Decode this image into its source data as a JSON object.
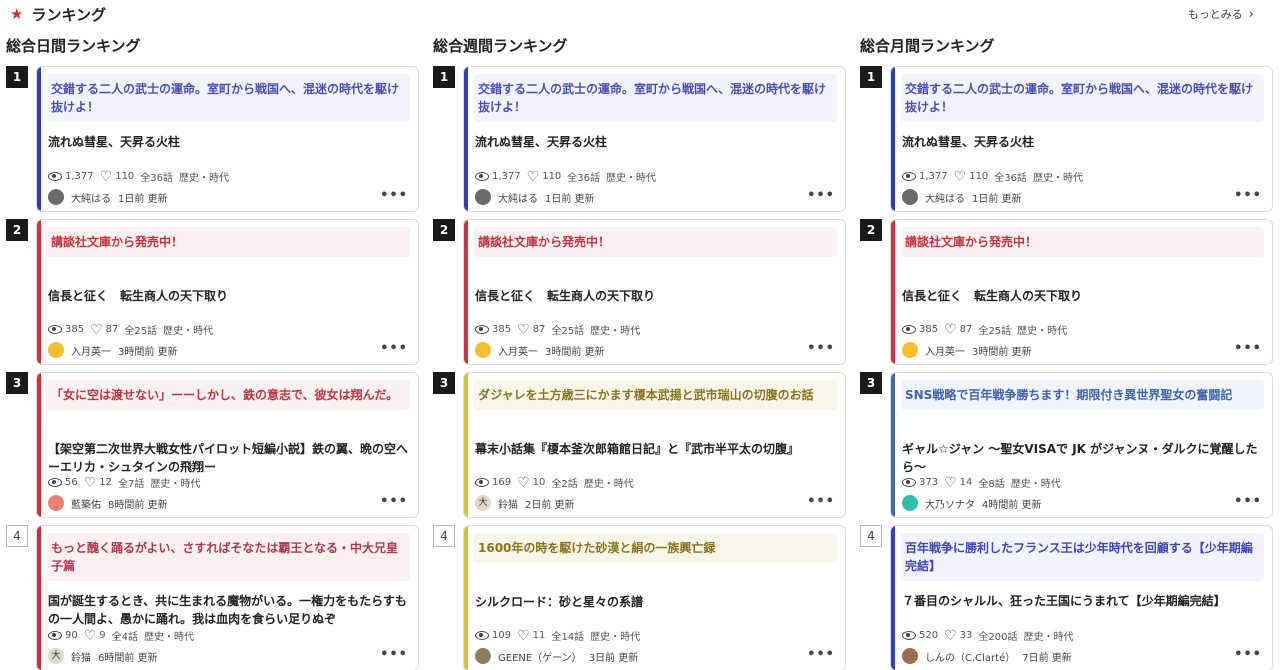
{
  "header": {
    "title": "ランキング",
    "more_label": "もっとみる"
  },
  "columns": [
    {
      "title": "総合日間ランキング",
      "items": [
        {
          "rank": "1",
          "style": "blue",
          "banner": "交錯する二人の武士の運命。室町から戦国へ、混迷の時代を駆け抜けよ！",
          "title": "流れぬ彗星、天昇る火柱",
          "views": "1,377",
          "likes": "110",
          "episodes": "全36話",
          "genre": "歴史・時代",
          "author": "大純はる",
          "updated": "1日前 更新",
          "avatar_color": "#6a6a6a",
          "avatar_glyph": ""
        },
        {
          "rank": "2",
          "style": "red",
          "banner": "講談社文庫から発売中！",
          "title": "信長と征く　転生商人の天下取り",
          "views": "385",
          "likes": "87",
          "episodes": "全25話",
          "genre": "歴史・時代",
          "author": "入月英一",
          "updated": "3時間前 更新",
          "avatar_color": "#f5c030",
          "avatar_glyph": ""
        },
        {
          "rank": "3",
          "style": "red",
          "banner": "「女に空は渡せない」ーーしかし、鉄の意志で、彼女は翔んだ。",
          "title": "【架空第二次世界大戦女性パイロット短編小説】鉄の翼、晩の空へ　ーエリカ・シュタインの飛翔ー",
          "views": "56",
          "likes": "12",
          "episodes": "全7話",
          "genre": "歴史・時代",
          "author": "藍築佑",
          "updated": "8時間前 更新",
          "avatar_color": "#f08070",
          "avatar_glyph": ""
        },
        {
          "rank": "4",
          "style": "maroon",
          "banner": "もっと醜く踊るがよい、さすればそなたは覇王となる・中大兄皇子篇",
          "title": "国が誕生するとき、共に生まれる魔物がいる。一権力をもたらすもの一人間よ、愚かに踊れ。我は血肉を食らい足りぬぞ",
          "views": "90",
          "likes": "9",
          "episodes": "全4話",
          "genre": "歴史・時代",
          "author": "鈴猫",
          "updated": "6時間前 更新",
          "avatar_color": "#e0d8c8",
          "avatar_glyph": "大"
        }
      ]
    },
    {
      "title": "総合週間ランキング",
      "items": [
        {
          "rank": "1",
          "style": "blue",
          "banner": "交錯する二人の武士の運命。室町から戦国へ、混迷の時代を駆け抜けよ！",
          "title": "流れぬ彗星、天昇る火柱",
          "views": "1,377",
          "likes": "110",
          "episodes": "全36話",
          "genre": "歴史・時代",
          "author": "大純はる",
          "updated": "1日前 更新",
          "avatar_color": "#6a6a6a",
          "avatar_glyph": ""
        },
        {
          "rank": "2",
          "style": "red",
          "banner": "講談社文庫から発売中！",
          "title": "信長と征く　転生商人の天下取り",
          "views": "385",
          "likes": "87",
          "episodes": "全25話",
          "genre": "歴史・時代",
          "author": "入月英一",
          "updated": "3時間前 更新",
          "avatar_color": "#f5c030",
          "avatar_glyph": ""
        },
        {
          "rank": "3",
          "style": "yellow",
          "banner": "ダジャレを土方歳三にかます榎本武揚と武市瑞山の切腹のお話",
          "title": "幕末小話集『榎本釜次郎箱館日記』と『武市半平太の切腹』",
          "views": "169",
          "likes": "10",
          "episodes": "全2話",
          "genre": "歴史・時代",
          "author": "鈴猫",
          "updated": "2日前 更新",
          "avatar_color": "#e0d8c8",
          "avatar_glyph": "大"
        },
        {
          "rank": "4",
          "style": "yellow",
          "banner": "1600年の時を駆けた砂漠と絹の一族興亡録",
          "title": "シルクロード：砂と星々の系譜",
          "views": "109",
          "likes": "11",
          "episodes": "全14話",
          "genre": "歴史・時代",
          "author": "GEENE（ゲーン）",
          "updated": "3日前 更新",
          "avatar_color": "#8a8060",
          "avatar_glyph": ""
        }
      ]
    },
    {
      "title": "総合月間ランキング",
      "items": [
        {
          "rank": "1",
          "style": "blue",
          "banner": "交錯する二人の武士の運命。室町から戦国へ、混迷の時代を駆け抜けよ！",
          "title": "流れぬ彗星、天昇る火柱",
          "views": "1,377",
          "likes": "110",
          "episodes": "全36話",
          "genre": "歴史・時代",
          "author": "大純はる",
          "updated": "1日前 更新",
          "avatar_color": "#6a6a6a",
          "avatar_glyph": ""
        },
        {
          "rank": "2",
          "style": "red",
          "banner": "講談社文庫から発売中！",
          "title": "信長と征く　転生商人の天下取り",
          "views": "385",
          "likes": "87",
          "episodes": "全25話",
          "genre": "歴史・時代",
          "author": "入月英一",
          "updated": "3時間前 更新",
          "avatar_color": "#f5c030",
          "avatar_glyph": ""
        },
        {
          "rank": "3",
          "style": "steel",
          "banner": "SNS戦略で百年戦争勝ちます！期限付き異世界聖女の奮闘記",
          "title": "ギャル☆ジャン 〜聖女VISAで JK がジャンヌ・ダルクに覚醒したら〜",
          "views": "373",
          "likes": "14",
          "episodes": "全8話",
          "genre": "歴史・時代",
          "author": "大乃ソナタ",
          "updated": "4時間前 更新",
          "avatar_color": "#30c0a8",
          "avatar_glyph": ""
        },
        {
          "rank": "4",
          "style": "indigo",
          "banner": "百年戦争に勝利したフランス王は少年時代を回顧する【少年期編完結】",
          "title": "７番目のシャルル、狂った王国にうまれて【少年期編完結】",
          "views": "520",
          "likes": "33",
          "episodes": "全200話",
          "genre": "歴史・時代",
          "author": "しんの（C.Clarté）",
          "updated": "7日前 更新",
          "avatar_color": "#9a7050",
          "avatar_glyph": ""
        }
      ]
    }
  ]
}
